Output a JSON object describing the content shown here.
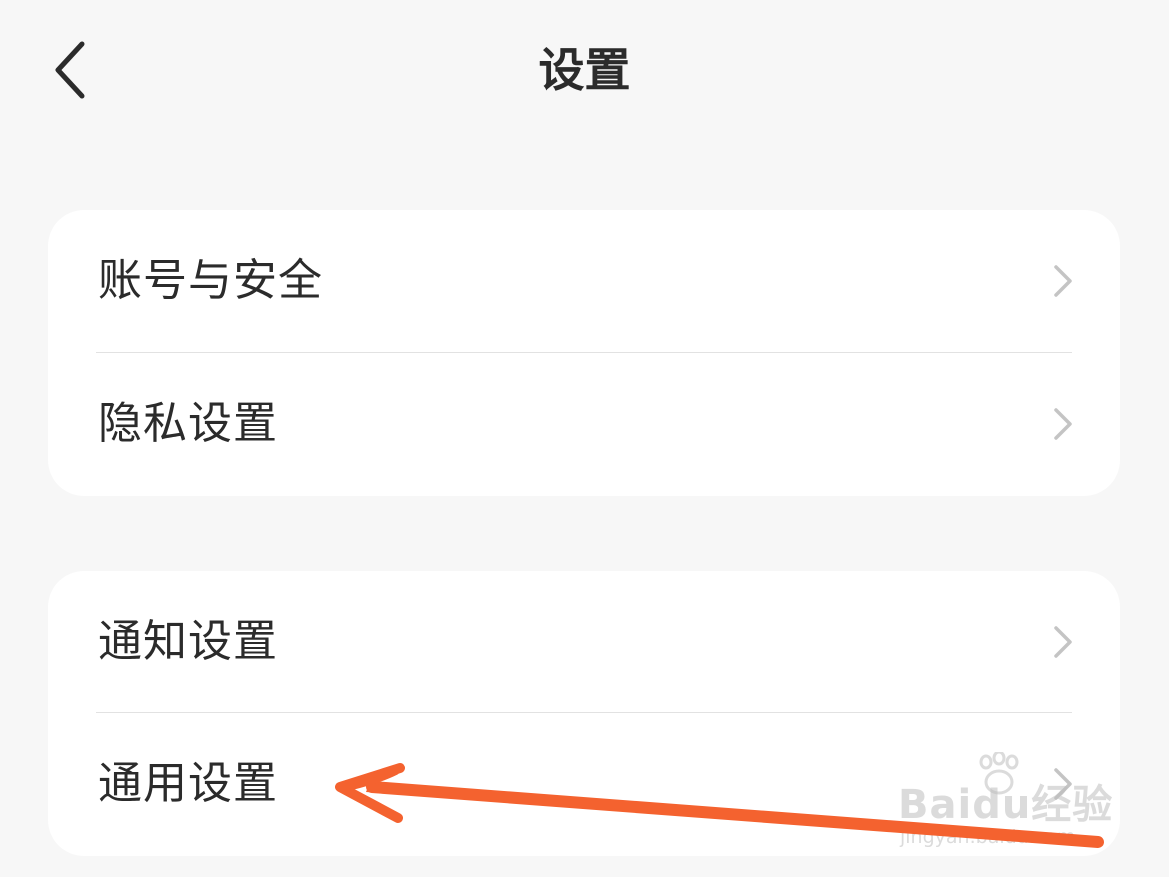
{
  "header": {
    "title": "设置",
    "back_icon": "chevron-left-icon"
  },
  "groups": [
    {
      "items": [
        {
          "label": "账号与安全",
          "icon": "chevron-right-icon"
        },
        {
          "label": "隐私设置",
          "icon": "chevron-right-icon"
        }
      ]
    },
    {
      "items": [
        {
          "label": "通知设置",
          "icon": "chevron-right-icon"
        },
        {
          "label": "通用设置",
          "icon": "chevron-right-icon"
        }
      ]
    }
  ],
  "annotation": {
    "type": "arrow",
    "color": "#f4622f",
    "points_to": "通用设置"
  },
  "watermark": {
    "brand": "Baidu经验",
    "url": "jingyan.baidu.com"
  },
  "colors": {
    "background": "#f7f7f7",
    "card": "#ffffff",
    "text": "#2b2b2b",
    "chevron": "#c4c4c4",
    "divider": "#e2e2e2"
  }
}
